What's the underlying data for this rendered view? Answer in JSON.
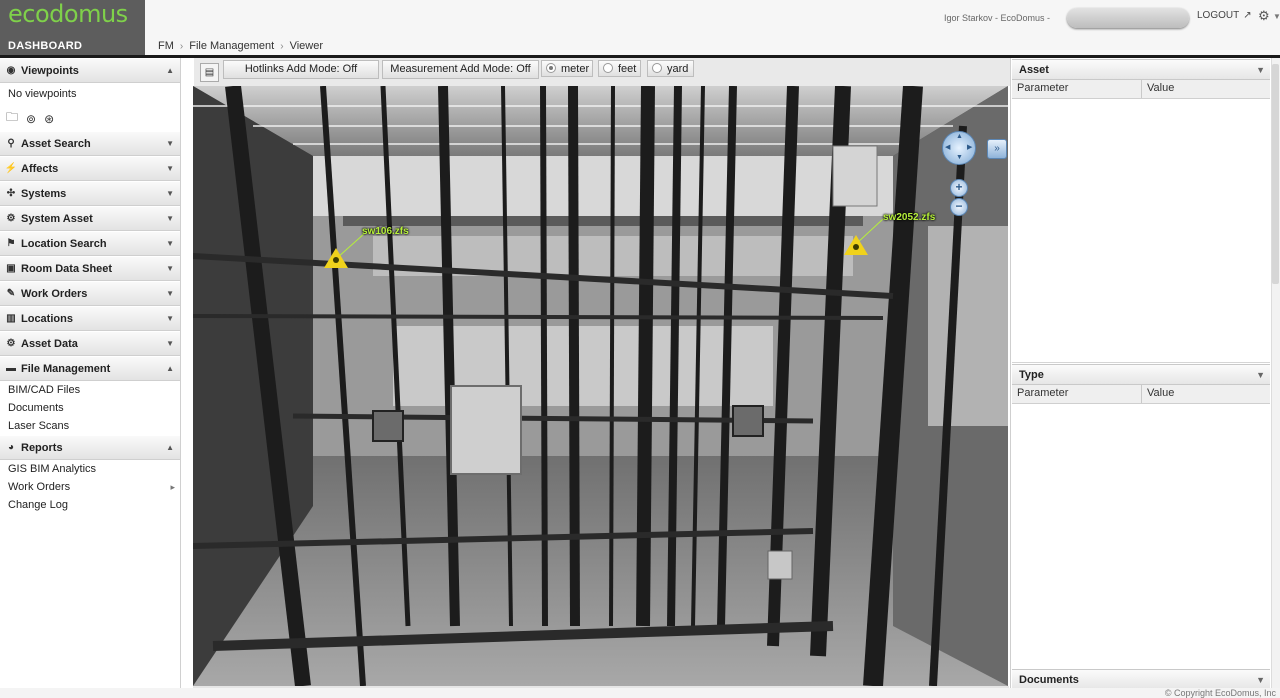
{
  "header": {
    "logo": "ecodomus",
    "dashboard_label": "DASHBOARD",
    "breadcrumb": [
      "FM",
      "File Management",
      "Viewer"
    ],
    "user": "Igor Starkov - EcoDomus -",
    "logout_label": "LOGOUT",
    "logout_icon": "external-link-arrow",
    "settings_icon": "gear"
  },
  "sidebar": {
    "viewpoints": {
      "title": "Viewpoints",
      "empty_text": "No viewpoints",
      "tools": [
        "new-folder-icon",
        "camera-icon",
        "camera-search-icon"
      ]
    },
    "sections": [
      {
        "label": "Asset Search",
        "icon": "search"
      },
      {
        "label": "Affects",
        "icon": "lightning"
      },
      {
        "label": "Systems",
        "icon": "network"
      },
      {
        "label": "System Asset",
        "icon": "asset"
      },
      {
        "label": "Location Search",
        "icon": "pin"
      },
      {
        "label": "Room Data Sheet",
        "icon": "sheet"
      },
      {
        "label": "Work Orders",
        "icon": "edit"
      },
      {
        "label": "Locations",
        "icon": "building"
      },
      {
        "label": "Asset Data",
        "icon": "gear"
      }
    ],
    "file_management": {
      "title": "File Management",
      "items": [
        "BIM/CAD Files",
        "Documents",
        "Laser Scans"
      ]
    },
    "reports": {
      "title": "Reports",
      "items": [
        "GIS BIM Analytics",
        "Work Orders",
        "Change Log"
      ]
    }
  },
  "viewer": {
    "hotlinks_mode": "Hotlinks Add Mode: Off",
    "measurement_mode": "Measurement Add Mode: Off",
    "units": [
      {
        "label": "meter",
        "selected": true
      },
      {
        "label": "feet",
        "selected": false
      },
      {
        "label": "yard",
        "selected": false
      }
    ],
    "hotlinks": [
      "sw106.zfs",
      "sw2052.zfs"
    ],
    "colors": {
      "hotlink_label": "#b6f03a",
      "hotlink_marker": "#f0d21c"
    }
  },
  "panels": {
    "asset": {
      "title": "Asset",
      "columns": [
        "Parameter",
        "Value"
      ]
    },
    "type": {
      "title": "Type",
      "columns": [
        "Parameter",
        "Value"
      ]
    },
    "documents": {
      "title": "Documents"
    }
  },
  "footer": {
    "copyright": "© Copyright  EcoDomus, Inc"
  },
  "colors": {
    "logo_green": "#7fd14a",
    "header_dark": "#5d5d5d"
  }
}
